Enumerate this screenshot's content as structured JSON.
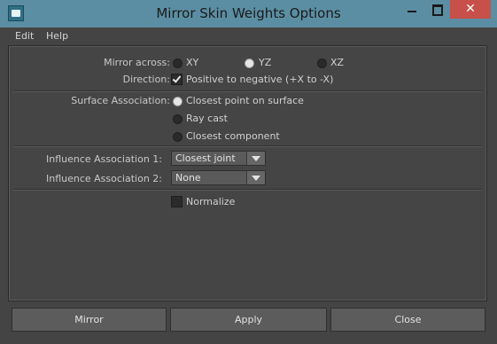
{
  "window": {
    "title": "Mirror Skin Weights Options",
    "controls": {
      "minimize_icon": "minimize-icon",
      "maximize_icon": "maximize-icon",
      "close_glyph": "✕"
    }
  },
  "menu": {
    "items": [
      "Edit",
      "Help"
    ]
  },
  "mirror_across": {
    "label": "Mirror across:",
    "options": [
      "XY",
      "YZ",
      "XZ"
    ],
    "selected": "YZ"
  },
  "direction": {
    "label": "Direction:",
    "checkbox_label": "Positive to negative (+X to -X)",
    "checked": true
  },
  "surface_association": {
    "label": "Surface Association:",
    "options": [
      "Closest point on surface",
      "Ray cast",
      "Closest component"
    ],
    "selected": "Closest point on surface"
  },
  "influence_association_1": {
    "label": "Influence Association 1:",
    "value": "Closest joint"
  },
  "influence_association_2": {
    "label": "Influence Association 2:",
    "value": "None"
  },
  "normalize": {
    "label": "Normalize",
    "checked": false
  },
  "buttons": {
    "mirror": "Mirror",
    "apply": "Apply",
    "close": "Close"
  },
  "colors": {
    "titlebar": "#5b8ea3",
    "close_button": "#c7504a",
    "background": "#444444",
    "button": "#5c5c5c"
  }
}
